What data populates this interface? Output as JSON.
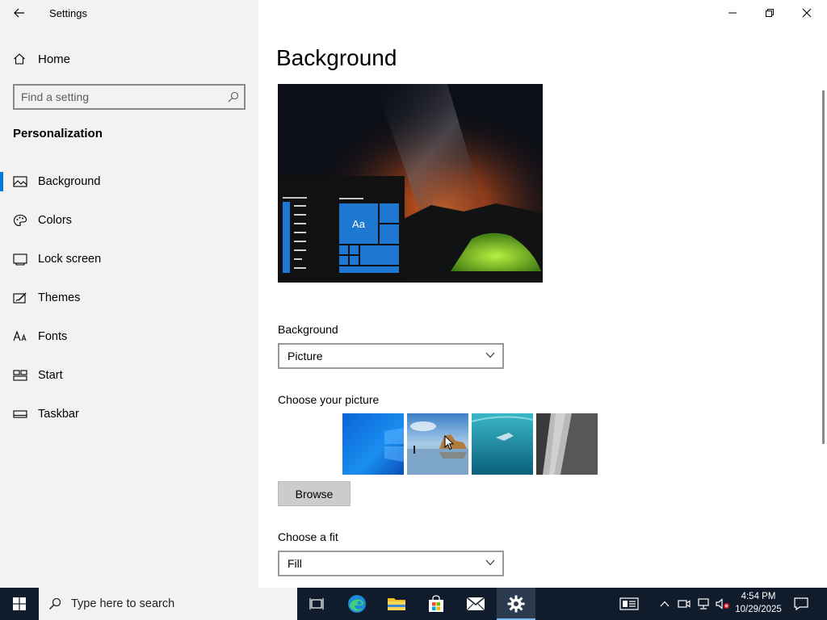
{
  "window": {
    "title": "Settings"
  },
  "sidebar": {
    "home_label": "Home",
    "search_placeholder": "Find a setting",
    "section_title": "Personalization",
    "items": [
      {
        "label": "Background",
        "icon": "picture-icon",
        "active": true
      },
      {
        "label": "Colors",
        "icon": "palette-icon",
        "active": false
      },
      {
        "label": "Lock screen",
        "icon": "lock-screen-icon",
        "active": false
      },
      {
        "label": "Themes",
        "icon": "themes-brush-icon",
        "active": false
      },
      {
        "label": "Fonts",
        "icon": "fonts-icon",
        "active": false
      },
      {
        "label": "Start",
        "icon": "start-tiles-icon",
        "active": false
      },
      {
        "label": "Taskbar",
        "icon": "taskbar-icon",
        "active": false
      }
    ]
  },
  "main": {
    "page_title": "Background",
    "preview_tile_text": "Aa",
    "background_label": "Background",
    "background_value": "Picture",
    "choose_picture_label": "Choose your picture",
    "browse_label": "Browse",
    "fit_label": "Choose a fit",
    "fit_value": "Fill"
  },
  "taskbar": {
    "search_placeholder": "Type here to search",
    "clock_time": "4:54 PM",
    "clock_date": "10/29/2025"
  },
  "colors": {
    "accent": "#0078d7",
    "sidebar_bg": "#f2f2f2",
    "taskbar_bg": "#101c2c"
  }
}
